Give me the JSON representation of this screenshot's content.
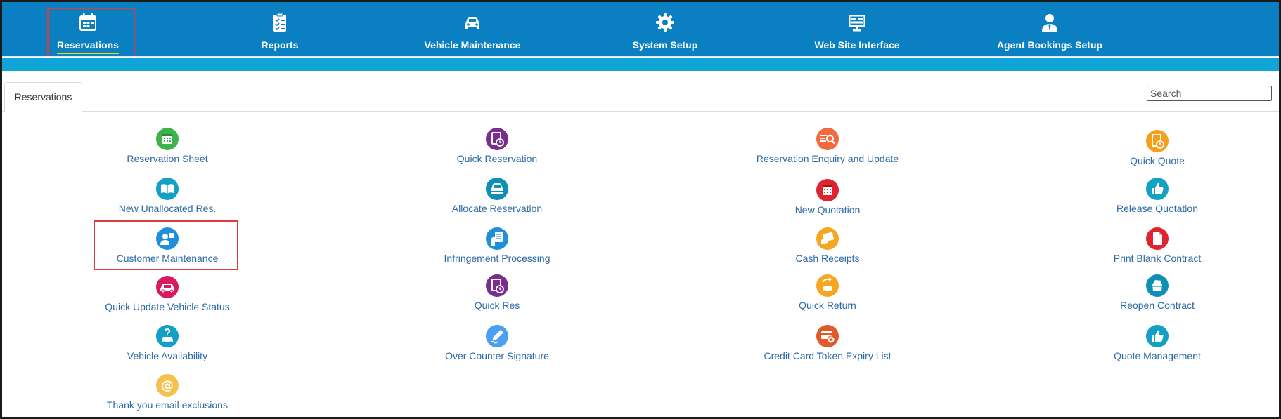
{
  "nav": {
    "items": [
      {
        "label": "Reservations",
        "icon": "calendar-icon",
        "active": true
      },
      {
        "label": "Reports",
        "icon": "clipboard-list-icon",
        "active": false
      },
      {
        "label": "Vehicle Maintenance",
        "icon": "car-icon",
        "active": false
      },
      {
        "label": "System Setup",
        "icon": "gear-icon",
        "active": false
      },
      {
        "label": "Web Site Interface",
        "icon": "monitor-icon",
        "active": false
      },
      {
        "label": "Agent Bookings Setup",
        "icon": "agent-user-icon",
        "active": false
      }
    ],
    "active_underline_color": "#e6e400",
    "bar_color": "#0a80c2",
    "sub_bar_color": "#0fa5d6"
  },
  "tabs": {
    "active": "Reservations"
  },
  "search": {
    "placeholder": "Search",
    "value": ""
  },
  "menu": {
    "columns": [
      [
        {
          "label": "Reservation Sheet",
          "icon": "calendar-grid-icon",
          "color": "#3cb44b"
        },
        {
          "label": "New Unallocated Res.",
          "icon": "open-book-icon",
          "color": "#12a0c4"
        },
        {
          "label": "Customer Maintenance",
          "icon": "customer-icon",
          "color": "#1e90d8",
          "highlighted": true
        },
        {
          "label": "Quick Update Vehicle Status",
          "icon": "car-icon",
          "color": "#d81b60"
        },
        {
          "label": "Vehicle Availability",
          "icon": "question-car-icon",
          "color": "#12a0c4"
        },
        {
          "label": "Thank you email exclusions",
          "icon": "at-sign-icon",
          "color": "#f2c14e"
        }
      ],
      [
        {
          "label": "Quick Reservation",
          "icon": "clipboard-clock-icon",
          "color": "#7b2d8e"
        },
        {
          "label": "Allocate Reservation",
          "icon": "car-front-icon",
          "color": "#0e8fb5"
        },
        {
          "label": "Infringement Processing",
          "icon": "document-hand-icon",
          "color": "#1e90d8"
        },
        {
          "label": "Quick Res",
          "icon": "clipboard-clock-icon",
          "color": "#7b2d8e"
        },
        {
          "label": "Over Counter Signature",
          "icon": "pen-signature-icon",
          "color": "#4a9ff0"
        }
      ],
      [
        {
          "label": "Reservation Enquiry and Update",
          "icon": "list-search-icon",
          "color": "#f26a3d"
        },
        {
          "label": "New Quotation",
          "icon": "calendar-grid-icon",
          "color": "#e0242f"
        },
        {
          "label": "Cash Receipts",
          "icon": "receipt-icon",
          "color": "#f5a623"
        },
        {
          "label": "Quick Return",
          "icon": "car-return-icon",
          "color": "#f5a623"
        },
        {
          "label": "Credit Card Token Expiry List",
          "icon": "card-cancel-icon",
          "color": "#e05a2b"
        }
      ],
      [
        {
          "label": "Quick Quote",
          "icon": "clipboard-clock-icon",
          "color": "#f5a01a"
        },
        {
          "label": "Release Quotation",
          "icon": "thumbs-up-icon",
          "color": "#12a0c4"
        },
        {
          "label": "Print Blank Contract",
          "icon": "document-icon",
          "color": "#e0242f"
        },
        {
          "label": "Reopen Contract",
          "icon": "open-box-icon",
          "color": "#0e8fb5"
        },
        {
          "label": "Quote Management",
          "icon": "thumbs-up-icon",
          "color": "#12a0c4"
        }
      ]
    ],
    "label_color": "#2c6aa6",
    "highlight_color": "#e03c3c"
  }
}
